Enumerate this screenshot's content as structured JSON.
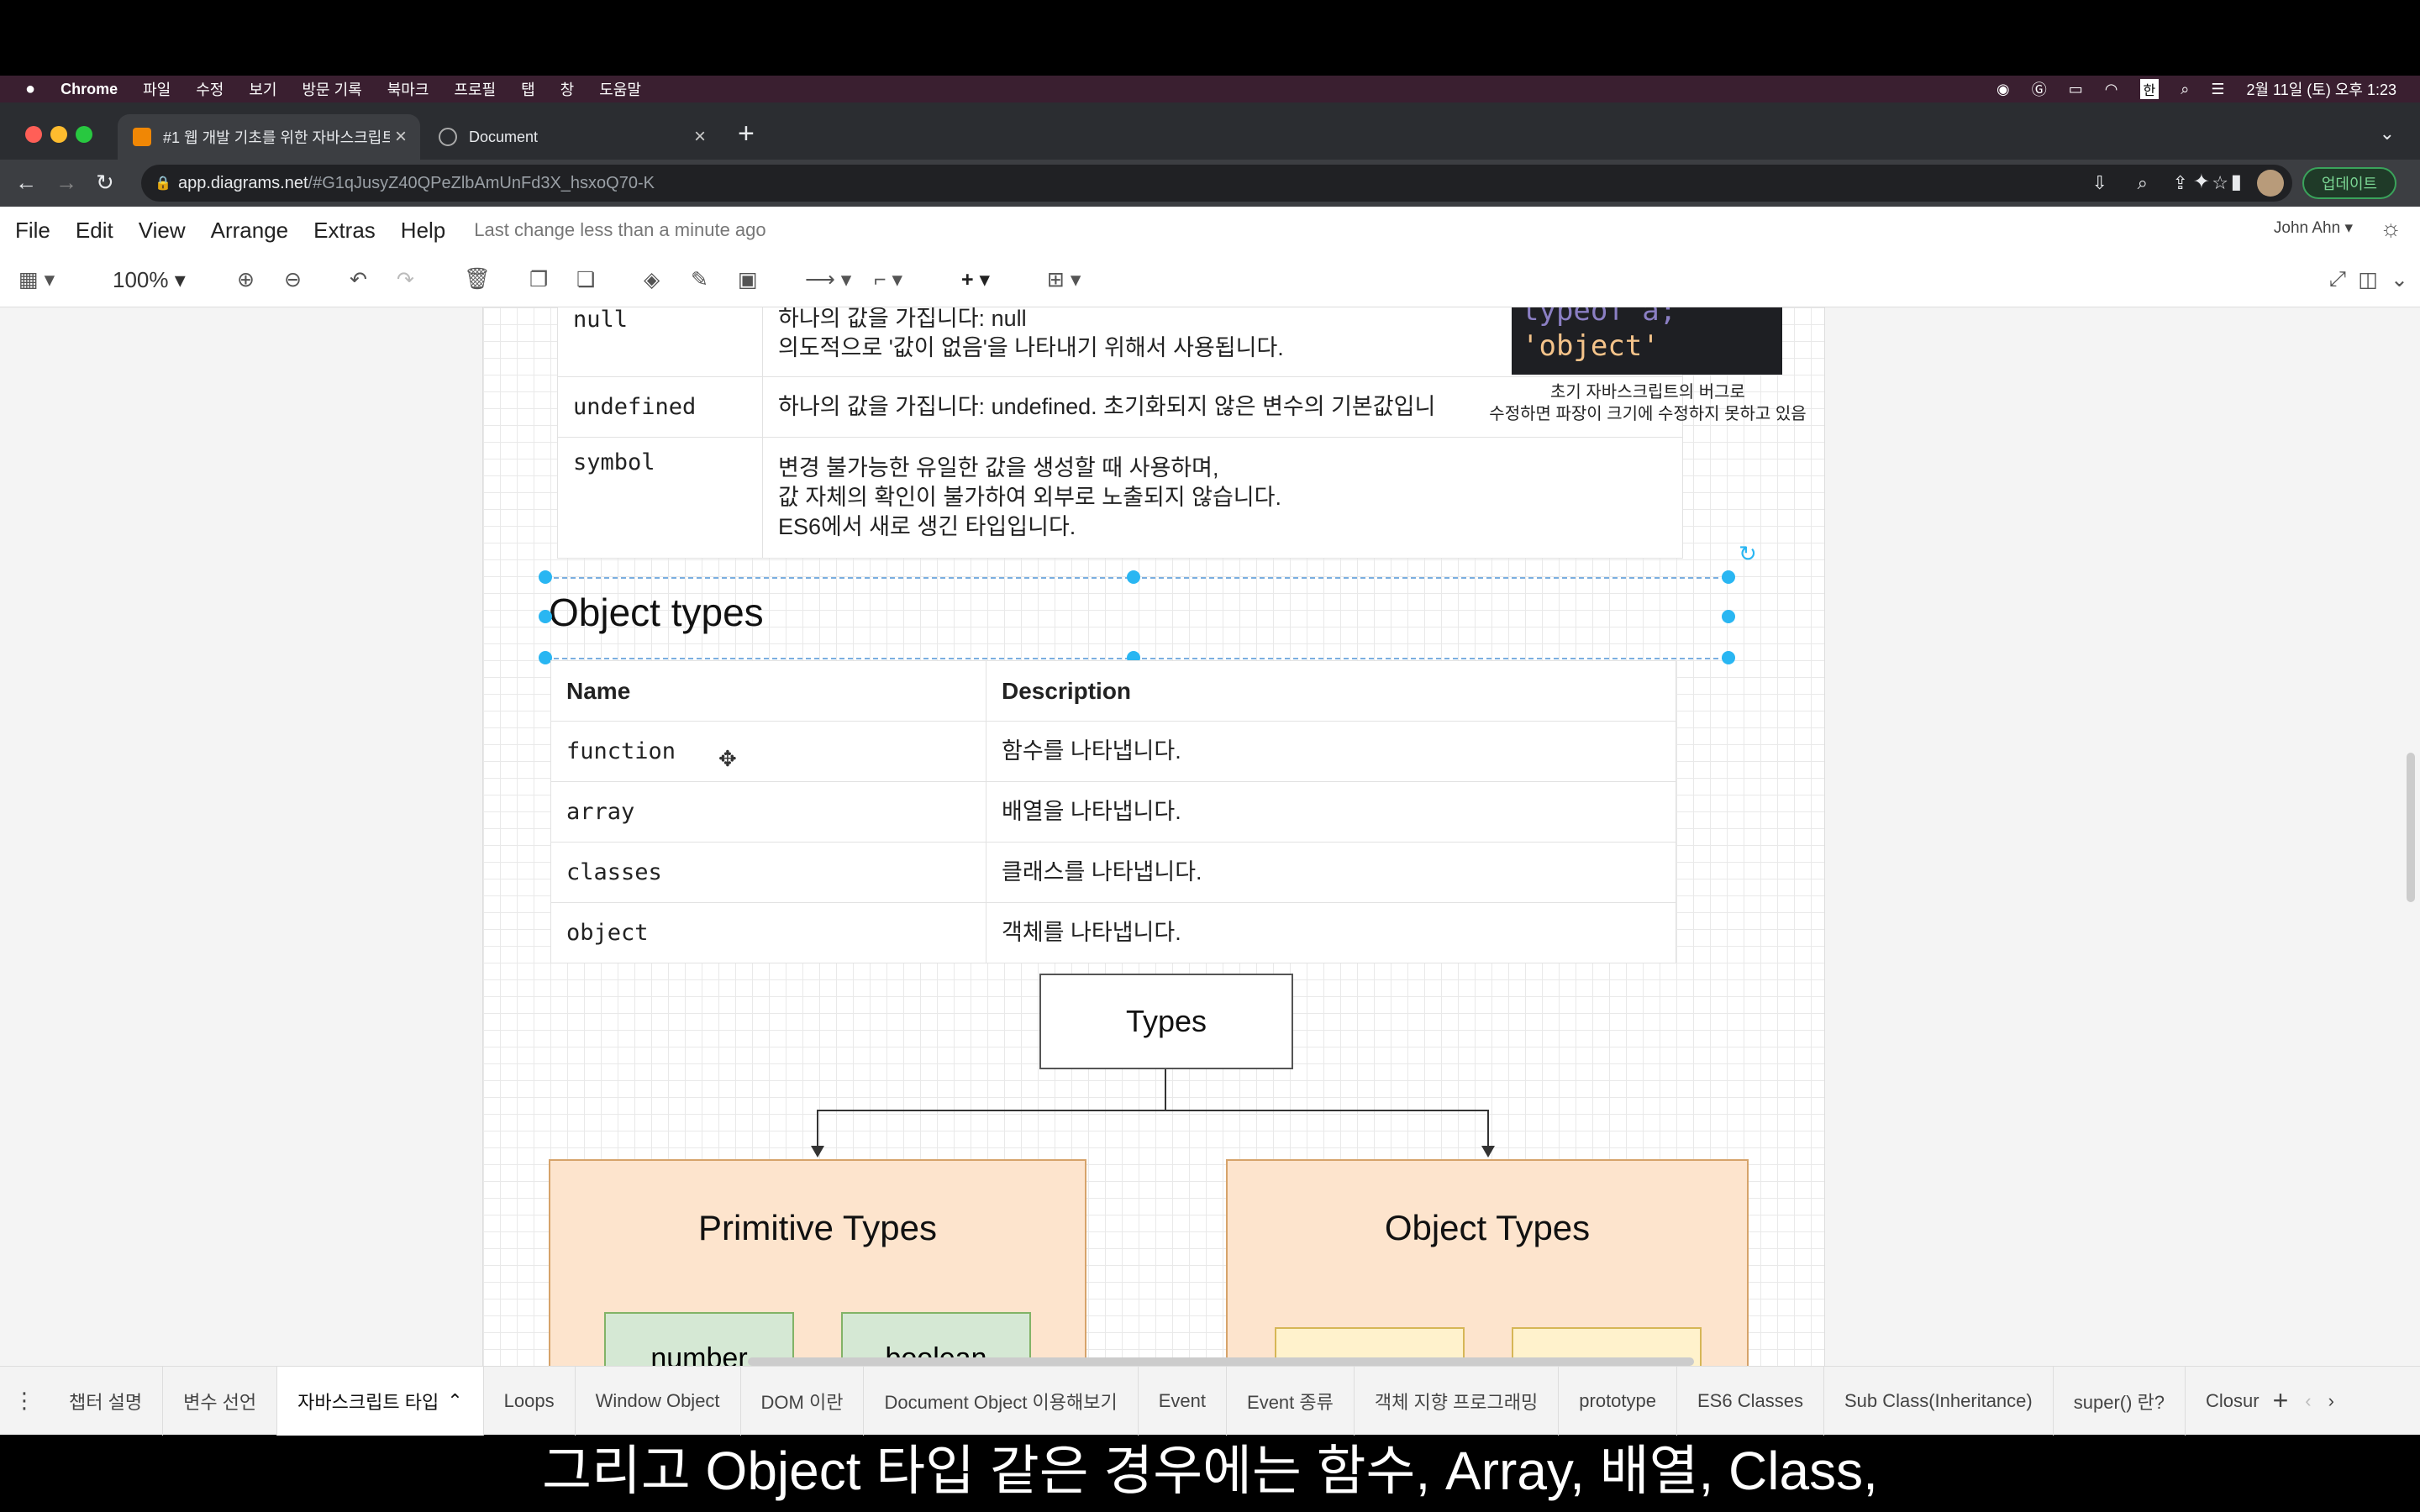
{
  "mac": {
    "app": "Chrome",
    "menus": [
      "파일",
      "수정",
      "보기",
      "방문 기록",
      "북마크",
      "프로필",
      "탭",
      "창",
      "도움말"
    ],
    "input_lang": "한",
    "clock": "2월 11일 (토) 오후 1:23"
  },
  "browser": {
    "tabs": [
      {
        "title": "#1 웹 개발 기초를 위한 자바스크립트",
        "active": true
      },
      {
        "title": "Document",
        "active": false
      }
    ],
    "url_host": "app.diagrams.net",
    "url_rest": "/#G1qJusyZ40QPeZlbAmUnFd3X_hsxoQ70-K",
    "update_label": "업데이트"
  },
  "app": {
    "menu": [
      "File",
      "Edit",
      "View",
      "Arrange",
      "Extras",
      "Help"
    ],
    "status": "Last change less than a minute ago",
    "user": "John Ahn",
    "zoom": "100%"
  },
  "primitive_table": {
    "rows": [
      {
        "name": "null",
        "desc": [
          "하나의 값을 가집니다: null",
          "의도적으로 '값이 없음'을 나타내기 위해서 사용됩니다."
        ]
      },
      {
        "name": "undefined",
        "desc": [
          "하나의 값을 가집니다: undefined. 초기화되지 않은 변수의 기본값입니"
        ]
      },
      {
        "name": "symbol",
        "desc": [
          "변경 불가능한 유일한 값을 생성할 때 사용하며,",
          "값 자체의 확인이 불가하여 외부로 노출되지 않습니다.",
          "ES6에서 새로 생긴 타입입니다."
        ]
      }
    ]
  },
  "code_box": {
    "line1": "typeof a;",
    "line2": "'object'"
  },
  "bug_note": [
    "초기 자바스크립트의 버그로",
    "수정하면 파장이 크기에 수정하지 못하고 있음"
  ],
  "object_types": {
    "title": "Object types",
    "headers": {
      "name": "Name",
      "desc": "Description"
    },
    "rows": [
      {
        "name": "function",
        "desc": "함수를 나타냅니다."
      },
      {
        "name": "array",
        "desc": "배열을 나타냅니다."
      },
      {
        "name": "classes",
        "desc": "클래스를 나타냅니다."
      },
      {
        "name": "object",
        "desc": "객체를 나타냅니다."
      }
    ]
  },
  "diagram": {
    "root": "Types",
    "left": "Primitive Types",
    "right": "Object Types",
    "left_children": [
      "number",
      "boolean"
    ]
  },
  "sheet_tabs": [
    "챕터 설명",
    "변수 선언",
    "자바스크립트 타입",
    "Loops",
    "Window Object",
    "DOM 이란",
    "Document Object 이용해보기",
    "Event",
    "Event 종류",
    "객체 지향 프로그래밍",
    "prototype",
    "ES6 Classes",
    "Sub Class(Inheritance)",
    "super() 란?",
    "Closur"
  ],
  "subtitle": "그리고 Object 타입 같은 경우에는 함수, Array, 배열, Class,"
}
